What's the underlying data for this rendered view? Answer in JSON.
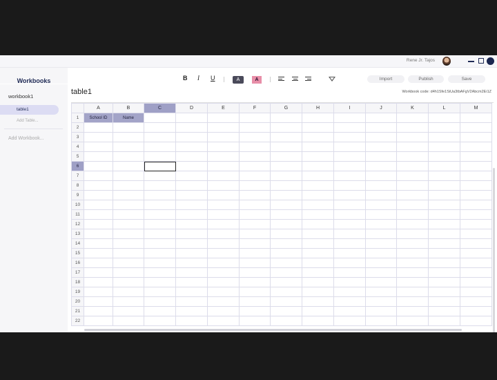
{
  "titlebar": {
    "user_name": "Rene Jr. Tajos"
  },
  "sidebar": {
    "title": "Workbooks",
    "workbook_name": "workbook1",
    "table_name": "table1",
    "add_table": "Add Table...",
    "add_workbook": "Add Workbook..."
  },
  "toolbar": {
    "bold": "B",
    "italic": "I",
    "underline": "U",
    "fill_label": "A",
    "font_color_label": "A",
    "import": "Import",
    "publish": "Publish",
    "save": "Save"
  },
  "sheet": {
    "title": "table1",
    "workbook_code": "Workbook code: d4h1Sfe1SiUa3tbAFgV2Abcm2Ei1Z",
    "columns": [
      "A",
      "B",
      "C",
      "D",
      "E",
      "F",
      "G",
      "H",
      "I",
      "J",
      "K",
      "L",
      "M"
    ],
    "selected_column": "C",
    "rows": [
      "1",
      "2",
      "3",
      "4",
      "5",
      "6",
      "7",
      "8",
      "9",
      "10",
      "11",
      "12",
      "13",
      "14",
      "15",
      "16",
      "17",
      "18",
      "19",
      "20",
      "21",
      "22"
    ],
    "selected_row": "6",
    "cells": {
      "A1": "School ID",
      "B1": "Name"
    },
    "active_cell": "C6"
  },
  "colors": {
    "accent": "#9fa0c6",
    "brand": "#1f2a55"
  }
}
